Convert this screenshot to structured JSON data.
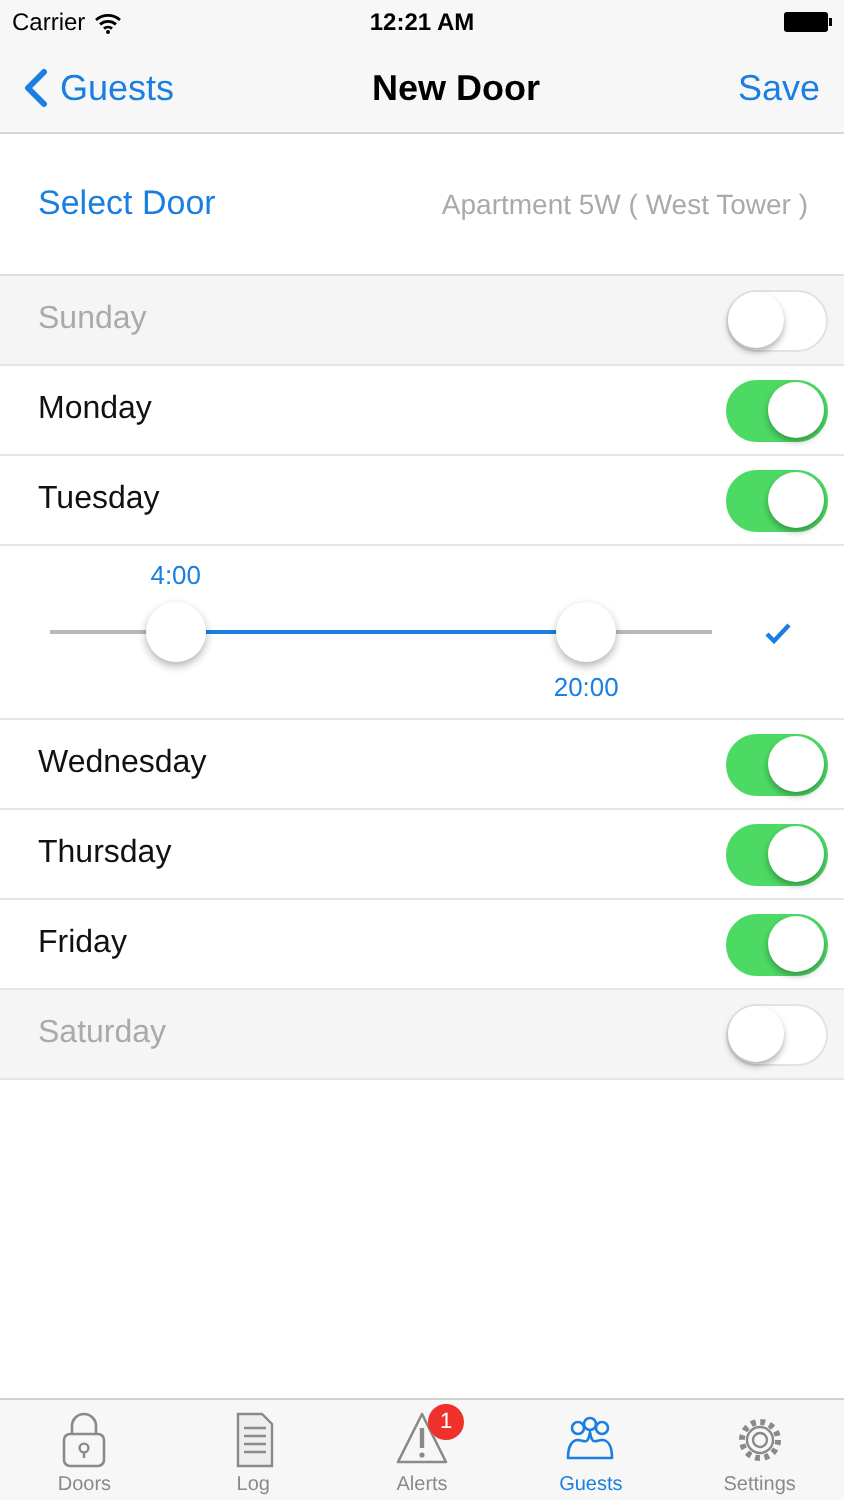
{
  "status_bar": {
    "carrier": "Carrier",
    "time": "12:21 AM"
  },
  "nav": {
    "back": "Guests",
    "title": "New Door",
    "action": "Save"
  },
  "door": {
    "label": "Select Door",
    "value": "Apartment 5W ( West Tower )"
  },
  "days": [
    {
      "name": "Sunday",
      "on": false
    },
    {
      "name": "Monday",
      "on": true
    },
    {
      "name": "Tuesday",
      "on": true,
      "range": {
        "low": {
          "level": 0.19,
          "label": "4:00"
        },
        "high": {
          "level": 0.81,
          "label": "20:00"
        },
        "confirmed": true
      }
    },
    {
      "name": "Wednesday",
      "on": true
    },
    {
      "name": "Thursday",
      "on": true
    },
    {
      "name": "Friday",
      "on": true
    },
    {
      "name": "Saturday",
      "on": false
    }
  ],
  "tabs": [
    {
      "kind": "lock",
      "label": "Doors",
      "selected": false
    },
    {
      "kind": "log",
      "label": "Log",
      "selected": false
    },
    {
      "kind": "alert",
      "label": "Alerts",
      "selected": false,
      "badge": "1"
    },
    {
      "kind": "guests",
      "label": "Guests",
      "selected": true
    },
    {
      "kind": "gear",
      "label": "Settings",
      "selected": false
    }
  ]
}
